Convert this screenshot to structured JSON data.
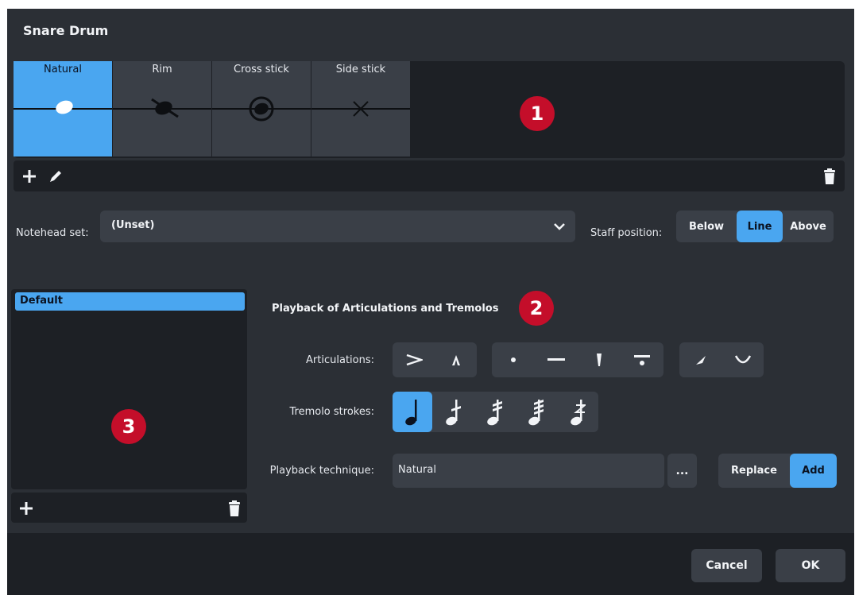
{
  "dialog": {
    "title": "Snare Drum"
  },
  "techniques": [
    {
      "label": "Natural",
      "selected": true,
      "notehead": "oval-notehead-icon"
    },
    {
      "label": "Rim",
      "selected": false,
      "notehead": "slashed-notehead-icon"
    },
    {
      "label": "Cross stick",
      "selected": false,
      "notehead": "circled-notehead-icon"
    },
    {
      "label": "Side stick",
      "selected": false,
      "notehead": "x-notehead-icon"
    }
  ],
  "callouts": [
    "1",
    "2",
    "3"
  ],
  "notehead_set": {
    "label": "Notehead set:",
    "value": "(Unset)"
  },
  "staff_position": {
    "label": "Staff position:",
    "options": [
      "Below",
      "Line",
      "Above"
    ],
    "selected": "Line"
  },
  "playback_list": {
    "items": [
      "Default"
    ],
    "selected": "Default"
  },
  "playback": {
    "heading": "Playback of Articulations and Tremolos",
    "articulations_label": "Articulations:",
    "tremolo_label": "Tremolo strokes:",
    "technique_label": "Playback technique:",
    "technique_value": "Natural",
    "more_label": "...",
    "mode_options": [
      "Replace",
      "Add"
    ],
    "mode_selected": "Add"
  },
  "footer": {
    "cancel": "Cancel",
    "ok": "OK"
  },
  "colors": {
    "accent": "#4aa6f0",
    "panel": "#2b2f35",
    "dark": "#1d2025",
    "control": "#3a3f47",
    "badge": "#c40e2a"
  }
}
